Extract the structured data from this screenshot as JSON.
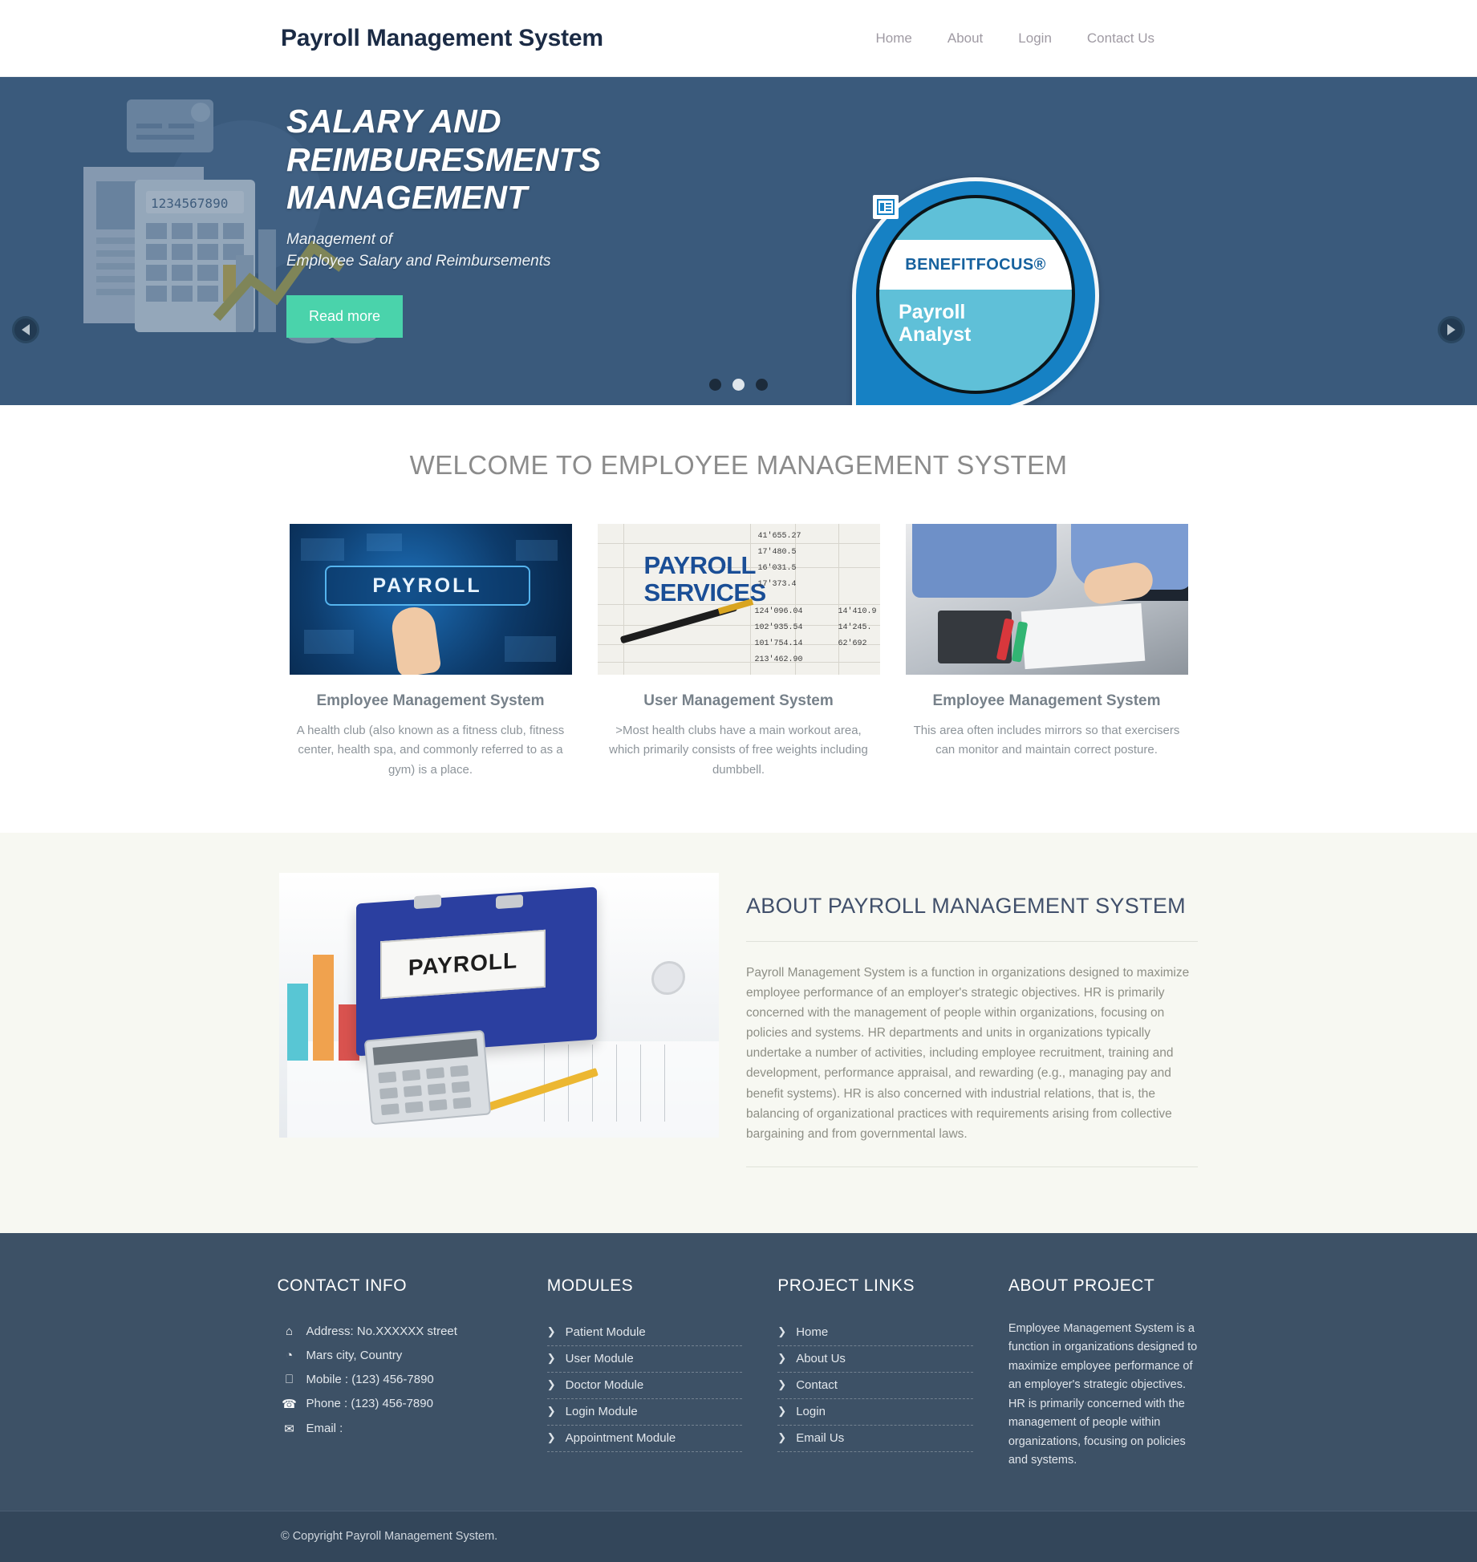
{
  "header": {
    "brand": "Payroll Management System",
    "nav": [
      {
        "label": "Home"
      },
      {
        "label": "About"
      },
      {
        "label": "Login"
      },
      {
        "label": "Contact Us"
      }
    ]
  },
  "hero": {
    "title": "SALARY AND REIMBURESMENTS MANAGEMENT",
    "subtitle_line1": "Management of",
    "subtitle_line2": "Employee Salary and Reimbursements",
    "read_more": "Read more",
    "badge": {
      "brand": "BENEFITFOCUS®",
      "role_line1": "Payroll",
      "role_line2": "Analyst"
    },
    "slides_total": 3,
    "active_slide": 2,
    "background_color": "#3a5a7c",
    "button_color": "#4ad3ab"
  },
  "welcome": {
    "title": "WELCOME TO EMPLOYEE MANAGEMENT SYSTEM",
    "cards": [
      {
        "image_label": "PAYROLL",
        "title": "Employee Management System",
        "text": "A health club (also known as a fitness club, fitness center, health spa, and commonly referred to as a gym) is a place."
      },
      {
        "image_label_line1": "PAYROLL",
        "image_label_line2": "SERVICES",
        "title": "User Management System",
        "text": ">Most health clubs have a main workout area, which primarily consists of free weights including dumbbell."
      },
      {
        "image_label": "",
        "title": "Employee Management System",
        "text": "This area often includes mirrors so that exercisers can monitor and maintain correct posture."
      }
    ]
  },
  "about": {
    "image_label": "PAYROLL",
    "title": "ABOUT PAYROLL MANAGEMENT SYSTEM",
    "text": "Payroll Management System is a function in organizations designed to maximize employee performance of an employer's strategic objectives. HR is primarily concerned with the management of people within organizations, focusing on policies and systems. HR departments and units in organizations typically undertake a number of activities, including employee recruitment, training and development, performance appraisal, and rewarding (e.g., managing pay and benefit systems). HR is also concerned with industrial relations, that is, the balancing of organizational practices with requirements arising from collective bargaining and from governmental laws."
  },
  "footer": {
    "contact": {
      "title": "CONTACT INFO",
      "lines": [
        {
          "icon": "home-icon",
          "glyph": "⌂",
          "text": "Address: No.XXXXXX street"
        },
        {
          "icon": "globe-icon",
          "glyph": "◔",
          "text": "Mars city, Country"
        },
        {
          "icon": "mobile-icon",
          "glyph": "⎕",
          "text": "Mobile : (123) 456-7890"
        },
        {
          "icon": "phone-icon",
          "glyph": "☎",
          "text": "Phone : (123) 456-7890"
        },
        {
          "icon": "envelope-icon",
          "glyph": "✉",
          "text": "Email :"
        }
      ]
    },
    "modules": {
      "title": "MODULES",
      "items": [
        {
          "label": "Patient Module"
        },
        {
          "label": "User Module"
        },
        {
          "label": "Doctor Module"
        },
        {
          "label": "Login Module"
        },
        {
          "label": "Appointment Module"
        }
      ]
    },
    "project_links": {
      "title": "PROJECT LINKS",
      "items": [
        {
          "label": "Home"
        },
        {
          "label": "About Us"
        },
        {
          "label": "Contact"
        },
        {
          "label": "Login"
        },
        {
          "label": "Email Us"
        }
      ]
    },
    "about_project": {
      "title": "ABOUT PROJECT",
      "text": "Employee Management System is a function in organizations designed to maximize employee performance of an employer's strategic objectives. HR is primarily concerned with the management of people within organizations, focusing on policies and systems."
    },
    "copyright": "© Copyright Payroll Management System."
  }
}
